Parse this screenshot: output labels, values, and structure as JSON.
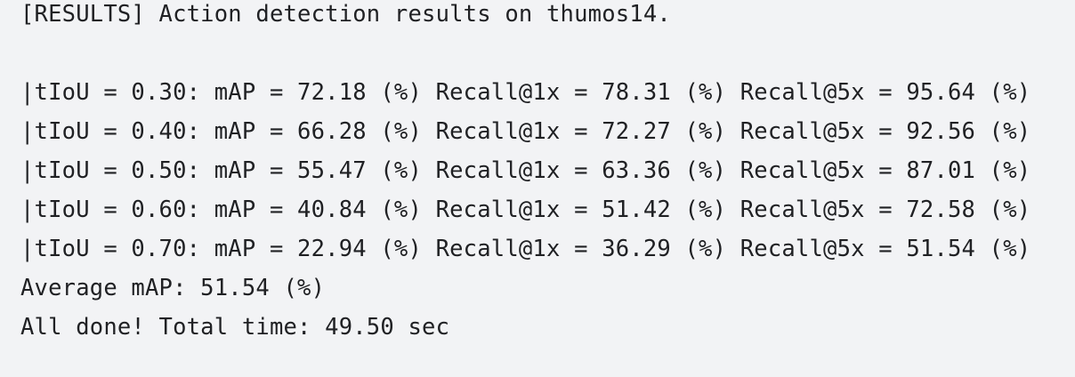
{
  "output": {
    "header": "[RESULTS] Action detection results on thumos14.",
    "result_lines": [
      "|tIoU = 0.30: mAP = 72.18 (%) Recall@1x = 78.31 (%) Recall@5x = 95.64 (%)",
      "|tIoU = 0.40: mAP = 66.28 (%) Recall@1x = 72.27 (%) Recall@5x = 92.56 (%)",
      "|tIoU = 0.50: mAP = 55.47 (%) Recall@1x = 63.36 (%) Recall@5x = 87.01 (%)",
      "|tIoU = 0.60: mAP = 40.84 (%) Recall@1x = 51.42 (%) Recall@5x = 72.58 (%)",
      "|tIoU = 0.70: mAP = 22.94 (%) Recall@1x = 36.29 (%) Recall@5x = 51.54 (%)"
    ],
    "average_map": "Average mAP: 51.54 (%)",
    "done_message": "All done! Total time: 49.50 sec"
  },
  "colors": {
    "background": "#f2f3f5",
    "text": "#202124"
  }
}
